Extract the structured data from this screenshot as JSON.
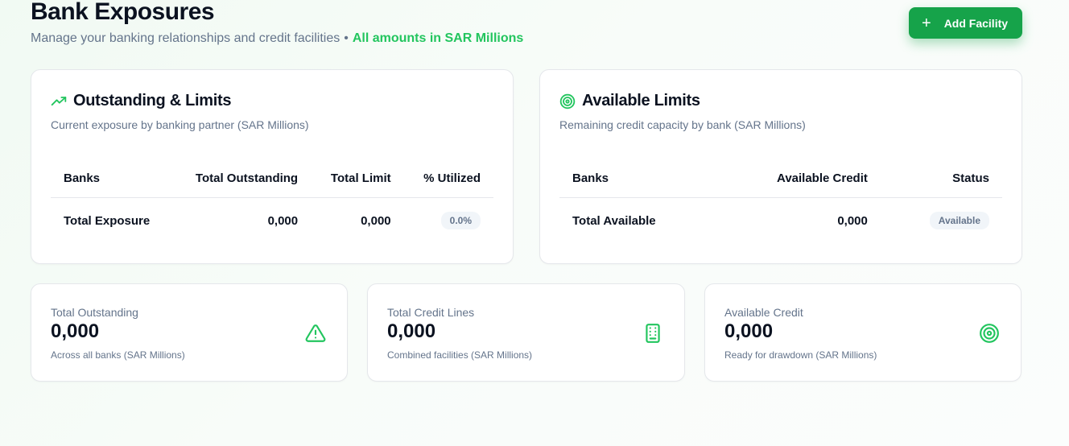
{
  "header": {
    "title": "Bank Exposures",
    "subtitle": "Manage your banking relationships and credit facilities",
    "separator": "•",
    "highlight": "All amounts in SAR Millions",
    "add_button_label": "Add Facility",
    "add_button_icon": "plus-icon"
  },
  "colors": {
    "accent": "#16a34a",
    "accent_light": "#22c55e",
    "muted_text": "#64748b"
  },
  "outstanding": {
    "title": "Outstanding & Limits",
    "icon": "trending-up-icon",
    "description": "Current exposure by banking partner (SAR Millions)",
    "columns": [
      "Banks",
      "Total Outstanding",
      "Total Limit",
      "% Utilized"
    ],
    "total_row": {
      "label": "Total Exposure",
      "outstanding": "0,000",
      "limit": "0,000",
      "utilized": "0.0%"
    }
  },
  "available": {
    "title": "Available Limits",
    "icon": "target-icon",
    "description": "Remaining credit capacity by bank (SAR Millions)",
    "columns": [
      "Banks",
      "Available Credit",
      "Status"
    ],
    "total_row": {
      "label": "Total Available",
      "credit": "0,000",
      "status": "Available"
    }
  },
  "stats": [
    {
      "label": "Total Outstanding",
      "value": "0,000",
      "note": "Across all banks (SAR Millions)",
      "icon": "alert-triangle-icon"
    },
    {
      "label": "Total Credit Lines",
      "value": "0,000",
      "note": "Combined facilities (SAR Millions)",
      "icon": "building-icon"
    },
    {
      "label": "Available Credit",
      "value": "0,000",
      "note": "Ready for drawdown (SAR Millions)",
      "icon": "target-icon"
    }
  ]
}
